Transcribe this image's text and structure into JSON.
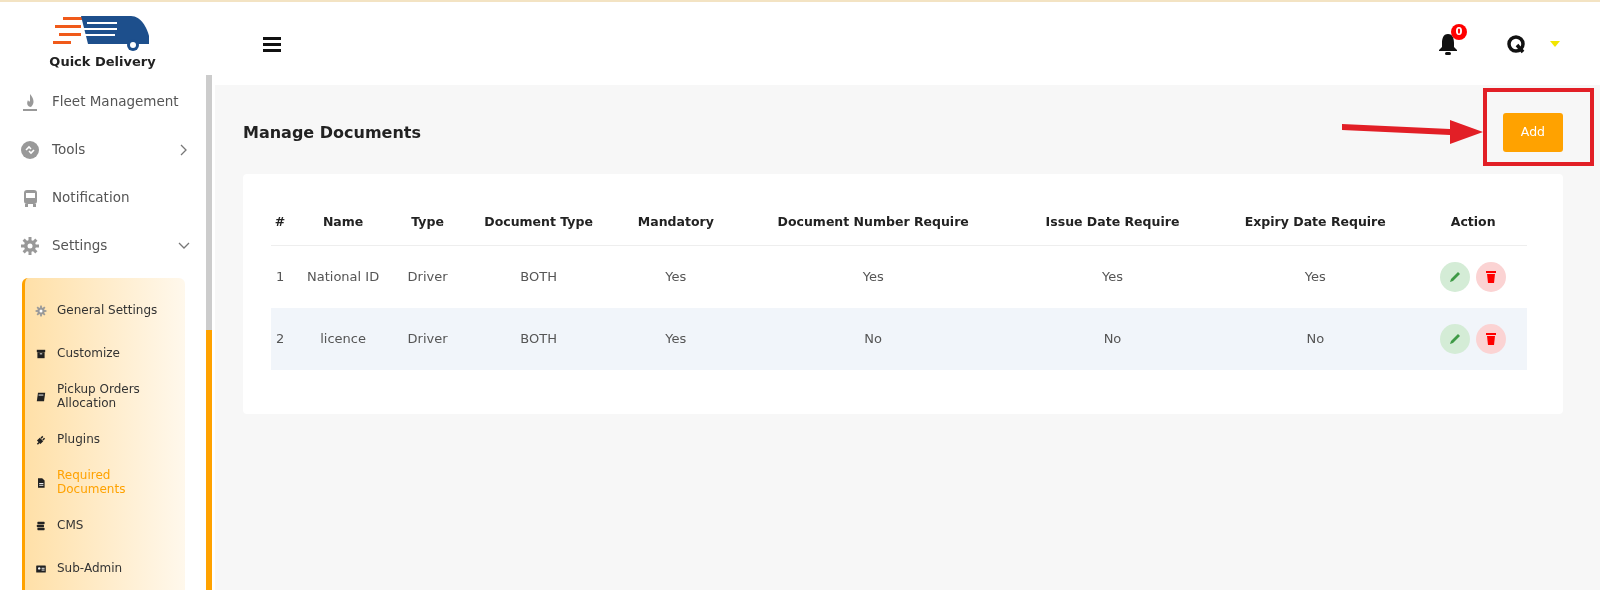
{
  "brand": {
    "name": "Quick Delivery"
  },
  "sidebar": {
    "items": [
      {
        "label": "Fleet Management"
      },
      {
        "label": "Tools",
        "expanded": false
      },
      {
        "label": "Notification"
      },
      {
        "label": "Settings",
        "expanded": true,
        "children": [
          {
            "label": "General Settings",
            "selected": false
          },
          {
            "label": "Customize",
            "selected": false
          },
          {
            "label": "Pickup Orders Allocation",
            "selected": false
          },
          {
            "label": "Plugins",
            "selected": false
          },
          {
            "label": "Required Documents",
            "selected": true
          },
          {
            "label": "CMS",
            "selected": false
          },
          {
            "label": "Sub-Admin",
            "selected": false
          }
        ]
      }
    ]
  },
  "header": {
    "notification_count": "0"
  },
  "page": {
    "title": "Manage Documents",
    "add_button": "Add"
  },
  "table": {
    "columns": [
      "#",
      "Name",
      "Type",
      "Document Type",
      "Mandatory",
      "Document Number Require",
      "Issue Date Require",
      "Expiry Date Require",
      "Action"
    ],
    "rows": [
      {
        "cells": [
          "1",
          "National ID",
          "Driver",
          "BOTH",
          "Yes",
          "Yes",
          "Yes",
          "Yes"
        ]
      },
      {
        "cells": [
          "2",
          "licence",
          "Driver",
          "BOTH",
          "Yes",
          "No",
          "No",
          "No"
        ]
      }
    ]
  }
}
